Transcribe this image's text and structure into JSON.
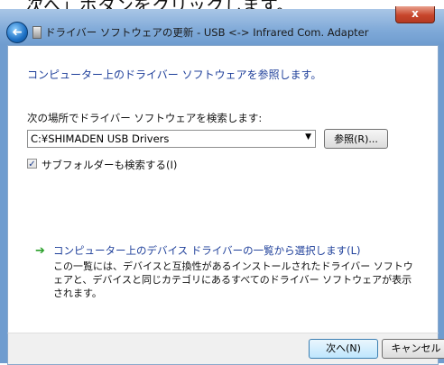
{
  "top_clip_text": "次へ」ボタンをクリックします。",
  "window": {
    "title": "ドライバー ソフトウェアの更新 - USB <-> Infrared Com. Adapter",
    "close_glyph": "x",
    "back_glyph": "➜"
  },
  "main": {
    "heading": "コンピューター上のドライバー ソフトウェアを参照します。",
    "search_label": "次の場所でドライバー ソフトウェアを検索します:",
    "path_value": "C:¥SHIMADEN USB Drivers",
    "dropdown_glyph": "▼",
    "browse_label": "参照(R)...",
    "subfolder_checked": true,
    "subfolder_label": "サブフォルダーも検索する(I)",
    "pick_link_title": "コンピューター上のデバイス ドライバーの一覧から選択します(L)",
    "pick_link_desc": "この一覧には、デバイスと互換性があるインストールされたドライバー ソフトウェアと、デバイスと同じカテゴリにあるすべてのドライバー ソフトウェアが表示されます。",
    "arrow_glyph": "➔"
  },
  "footer": {
    "next_label": "次へ(N)",
    "cancel_label": "キャンセル"
  },
  "colors": {
    "link_blue": "#1e3f9a",
    "window_frame": "#6f9ccf"
  }
}
